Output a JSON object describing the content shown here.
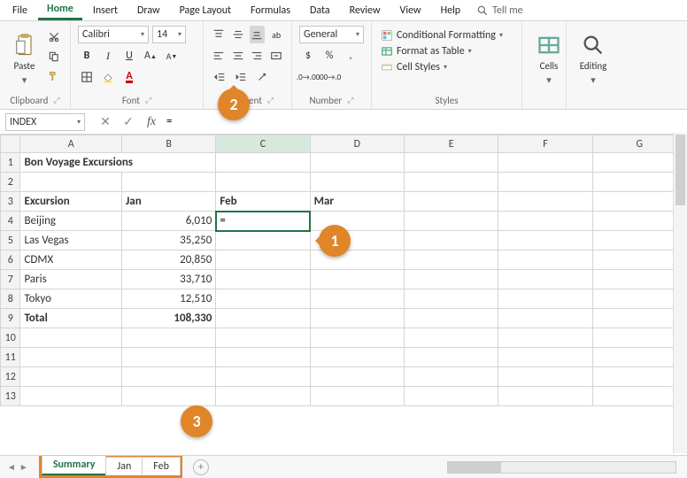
{
  "menubar": {
    "items": [
      "File",
      "Home",
      "Insert",
      "Draw",
      "Page Layout",
      "Formulas",
      "Data",
      "Review",
      "View",
      "Help"
    ],
    "active": "Home",
    "tellme": "Tell me"
  },
  "ribbon": {
    "clipboard": {
      "label": "Clipboard",
      "paste": "Paste"
    },
    "font": {
      "label": "Font",
      "name": "Calibri",
      "size": "14",
      "bold": "B",
      "italic": "I",
      "underline": "U"
    },
    "alignment": {
      "label": "Alignment",
      "wrap_icon": "ab"
    },
    "number": {
      "label": "Number",
      "format": "General",
      "currency": "$",
      "percent": "%",
      "comma": ","
    },
    "styles": {
      "label": "Styles",
      "conditional": "Conditional Formatting",
      "table": "Format as Table",
      "cell": "Cell Styles"
    },
    "cells": {
      "label": "Cells"
    },
    "editing": {
      "label": "Editing"
    }
  },
  "formula_bar": {
    "namebox": "INDEX",
    "formula": "=",
    "fx": "fx"
  },
  "grid": {
    "cols": [
      "A",
      "B",
      "C",
      "D",
      "E",
      "F",
      "G"
    ],
    "rows": [
      "1",
      "2",
      "3",
      "4",
      "5",
      "6",
      "7",
      "8",
      "9",
      "10",
      "11",
      "12",
      "13"
    ],
    "title": "Bon Voyage Excursions",
    "headers": {
      "a3": "Excursion",
      "b3": "Jan",
      "c3": "Feb",
      "d3": "Mar"
    },
    "data": [
      {
        "name": "Beijing",
        "jan": "6,010"
      },
      {
        "name": "Las Vegas",
        "jan": "35,250"
      },
      {
        "name": "CDMX",
        "jan": "20,850"
      },
      {
        "name": "Paris",
        "jan": "33,710"
      },
      {
        "name": "Tokyo",
        "jan": "12,510"
      }
    ],
    "total_label": "Total",
    "total_jan": "108,330",
    "active_cell_value": "="
  },
  "sheets": {
    "tabs": [
      "Summary",
      "Jan",
      "Feb"
    ],
    "active": "Summary"
  },
  "callouts": {
    "c1": "1",
    "c2": "2",
    "c3": "3"
  },
  "colors": {
    "accent": "#217346",
    "callout": "#e08528"
  }
}
